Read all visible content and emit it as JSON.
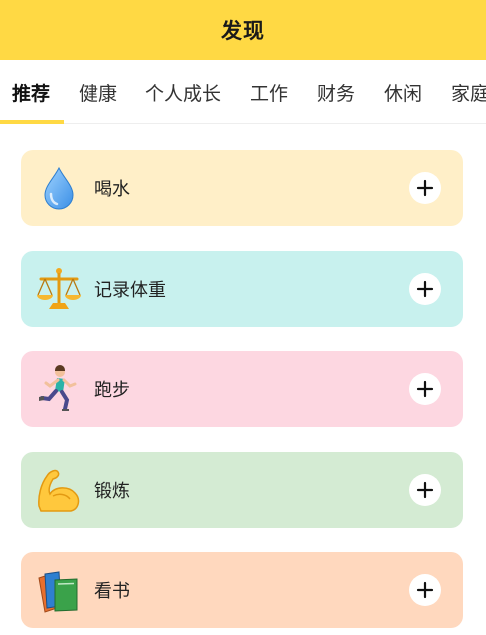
{
  "header": {
    "title": "发现"
  },
  "tabs": [
    {
      "label": "推荐",
      "active": true
    },
    {
      "label": "健康",
      "active": false
    },
    {
      "label": "个人成长",
      "active": false
    },
    {
      "label": "工作",
      "active": false
    },
    {
      "label": "财务",
      "active": false
    },
    {
      "label": "休闲",
      "active": false
    },
    {
      "label": "家庭",
      "active": false
    }
  ],
  "colors": {
    "accent": "#FFD944",
    "card_water": "#FFEFC8",
    "card_weight": "#C8F1EE",
    "card_running": "#FDD7E1",
    "card_exercise": "#D4EBD3",
    "card_reading": "#FFD8BE"
  },
  "habits": [
    {
      "label": "喝水",
      "icon": "water-drop-icon",
      "color": "#FFEFC8"
    },
    {
      "label": "记录体重",
      "icon": "balance-scale-icon",
      "color": "#C8F1EE"
    },
    {
      "label": "跑步",
      "icon": "running-person-icon",
      "color": "#FDD7E1"
    },
    {
      "label": "锻炼",
      "icon": "flexed-biceps-icon",
      "color": "#D4EBD3"
    },
    {
      "label": "看书",
      "icon": "books-icon",
      "color": "#FFD8BE"
    }
  ],
  "add_button_icon": "plus-icon"
}
